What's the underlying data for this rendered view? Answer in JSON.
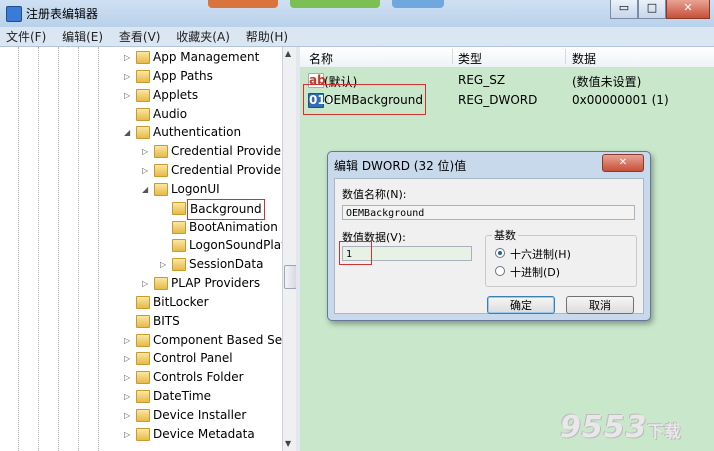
{
  "window": {
    "title": "注册表编辑器",
    "controls": {
      "minimize": "▭",
      "maximize": "□",
      "close": "✕"
    }
  },
  "menu": [
    "文件(F)",
    "编辑(E)",
    "查看(V)",
    "收藏夹(A)",
    "帮助(H)"
  ],
  "tree": {
    "items": [
      {
        "label": "App Management",
        "expander": "▷"
      },
      {
        "label": "App Paths",
        "expander": "▷"
      },
      {
        "label": "Applets",
        "expander": "▷"
      },
      {
        "label": "Audio",
        "expander": ""
      },
      {
        "label": "Authentication",
        "expander": "◢"
      },
      {
        "label": "Credential Provider",
        "expander": "▷"
      },
      {
        "label": "Credential Provider",
        "expander": "▷"
      },
      {
        "label": "LogonUI",
        "expander": "◢"
      },
      {
        "label": "Background",
        "expander": ""
      },
      {
        "label": "BootAnimation",
        "expander": ""
      },
      {
        "label": "LogonSoundPlay",
        "expander": ""
      },
      {
        "label": "SessionData",
        "expander": "▷"
      },
      {
        "label": "PLAP Providers",
        "expander": "▷"
      },
      {
        "label": "BitLocker",
        "expander": ""
      },
      {
        "label": "BITS",
        "expander": ""
      },
      {
        "label": "Component Based Ser",
        "expander": "▷"
      },
      {
        "label": "Control Panel",
        "expander": "▷"
      },
      {
        "label": "Controls Folder",
        "expander": "▷"
      },
      {
        "label": "DateTime",
        "expander": "▷"
      },
      {
        "label": "Device Installer",
        "expander": "▷"
      },
      {
        "label": "Device Metadata",
        "expander": "▷"
      }
    ]
  },
  "values": {
    "headers": {
      "name": "名称",
      "type": "类型",
      "data": "数据"
    },
    "rows": [
      {
        "icon": "ab",
        "name": "(默认)",
        "type": "REG_SZ",
        "data": "(数值未设置)"
      },
      {
        "icon": "011",
        "name": "OEMBackground",
        "type": "REG_DWORD",
        "data": "0x00000001 (1)"
      }
    ]
  },
  "dialog": {
    "title": "编辑 DWORD (32 位)值",
    "close": "✕",
    "name_label": "数值名称(N):",
    "name_value": "OEMBackground",
    "data_label": "数值数据(V):",
    "data_value": "1",
    "base_label": "基数",
    "hex_label": "十六进制(H)",
    "dec_label": "十进制(D)",
    "ok": "确定",
    "cancel": "取消"
  },
  "watermark": {
    "number": "9553",
    "text": "下载"
  },
  "colors": {
    "highlight": "#cc3333",
    "pane": "#c9e7cb"
  }
}
